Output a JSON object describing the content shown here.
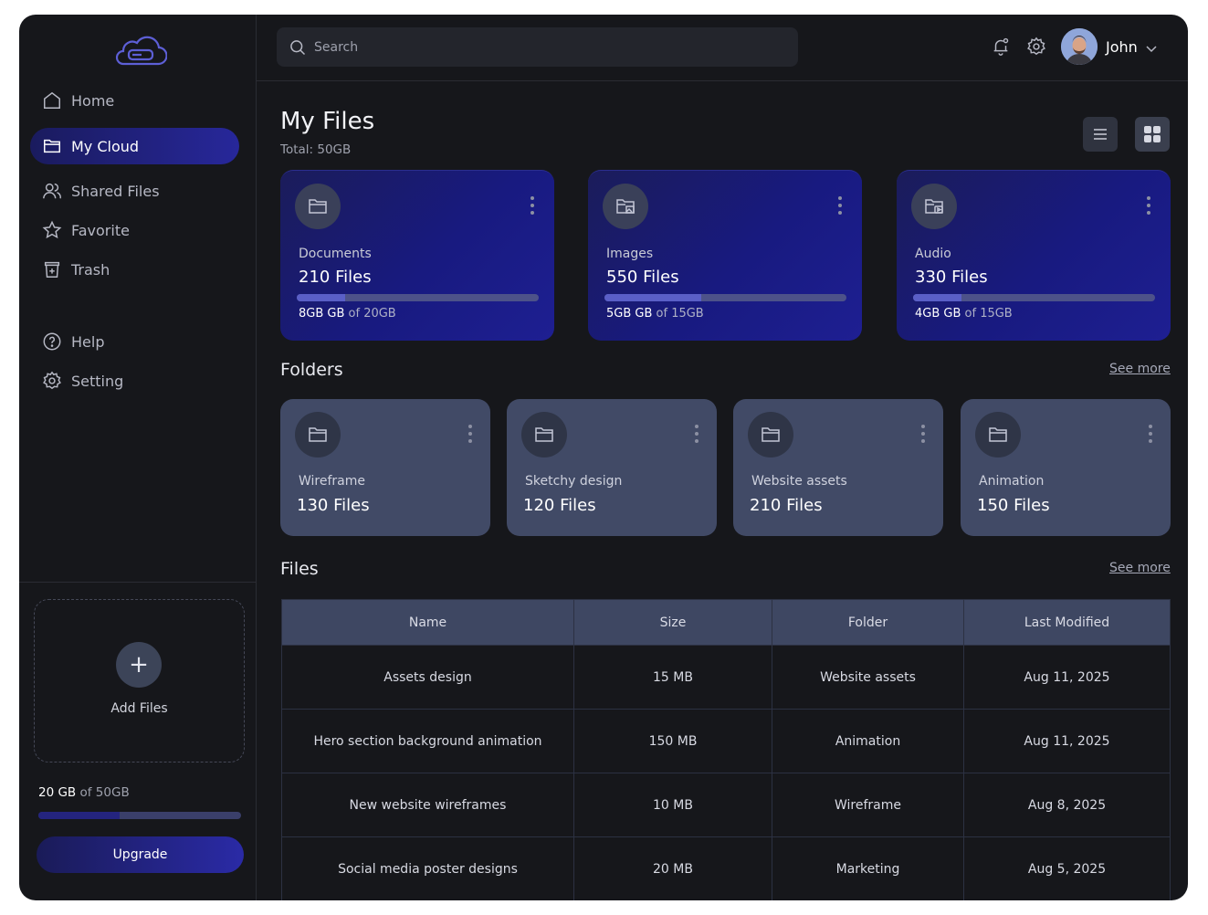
{
  "sidebar": {
    "nav": [
      {
        "label": "Home"
      },
      {
        "label": "My Cloud"
      },
      {
        "label": "Shared Files"
      },
      {
        "label": "Favorite"
      },
      {
        "label": "Trash"
      },
      {
        "label": "Help"
      },
      {
        "label": "Setting"
      }
    ],
    "active_item": "My Cloud",
    "add_files_label": "Add Files",
    "storage": {
      "used": "20 GB",
      "of_text": "of 50GB",
      "fraction": 0.4
    },
    "upgrade_label": "Upgrade"
  },
  "topbar": {
    "search_placeholder": "Search",
    "user_name": "John"
  },
  "main": {
    "title": "My Files",
    "total": "Total: 50GB",
    "view_mode": "grid",
    "categories": [
      {
        "label": "Documents",
        "count": "210 Files",
        "used": "8GB GB",
        "of_text": "of 20GB",
        "fraction": 0.2,
        "icon": "folder-icon"
      },
      {
        "label": "Images",
        "count": "550 Files",
        "used": "5GB GB",
        "of_text": "of 15GB",
        "fraction": 0.4,
        "icon": "image-folder-icon"
      },
      {
        "label": "Audio",
        "count": "330 Files",
        "used": "4GB GB",
        "of_text": "of 15GB",
        "fraction": 0.2,
        "icon": "audio-folder-icon"
      }
    ],
    "folders_title": "Folders",
    "folders_see_more": "See more",
    "folders": [
      {
        "label": "Wireframe",
        "count": "130 Files"
      },
      {
        "label": "Sketchy design",
        "count": "120 Files"
      },
      {
        "label": "Website assets",
        "count": "210 Files"
      },
      {
        "label": "Animation",
        "count": "150 Files"
      }
    ],
    "files_title": "Files",
    "files_see_more": "See more",
    "table": {
      "headers": [
        "Name",
        "Size",
        "Folder",
        "Last Modified"
      ],
      "rows": [
        [
          "Assets design",
          "15 MB",
          "Website assets",
          "Aug 11, 2025"
        ],
        [
          "Hero section background animation",
          "150 MB",
          "Animation",
          "Aug 11, 2025"
        ],
        [
          "New website wireframes",
          "10 MB",
          "Wireframe",
          "Aug 8, 2025"
        ],
        [
          "Social media poster designs",
          "20 MB",
          "Marketing",
          "Aug 5, 2025"
        ]
      ]
    }
  },
  "colors": {
    "accent": "#1f1f8a",
    "background": "#16171b",
    "folder_card": "#414a66"
  }
}
